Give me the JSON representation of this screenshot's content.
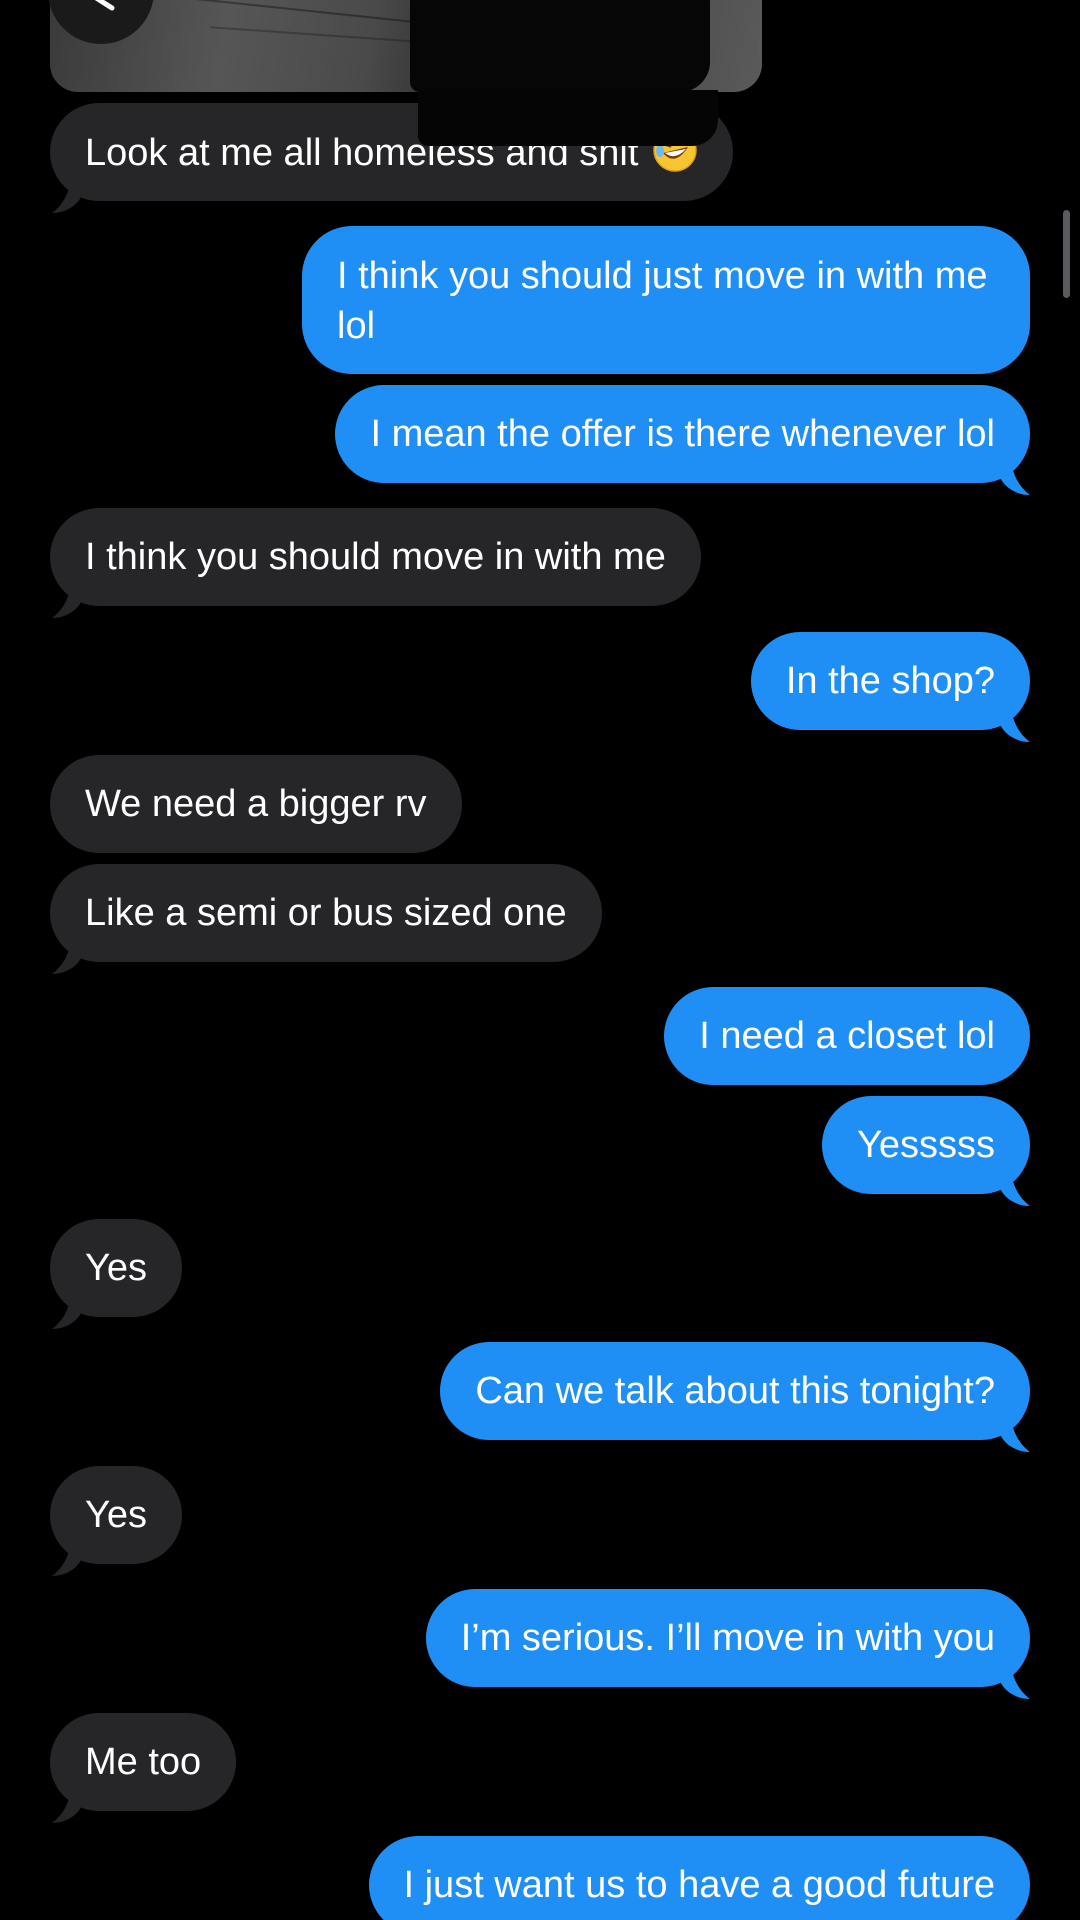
{
  "thread": {
    "messages": [
      {
        "id": 1,
        "direction": "incoming",
        "text": "Look at me all homeless and shit",
        "emoji": "rolling-on-floor-laughing",
        "tail": true
      },
      {
        "id": 2,
        "direction": "outgoing",
        "text": "I think you should just move in with me lol",
        "tail": false
      },
      {
        "id": 3,
        "direction": "outgoing",
        "text": "I mean the offer is there whenever lol",
        "tail": true
      },
      {
        "id": 4,
        "direction": "incoming",
        "text": "I think you should move in with me",
        "tail": true
      },
      {
        "id": 5,
        "direction": "outgoing",
        "text": "In the shop?",
        "tail": true
      },
      {
        "id": 6,
        "direction": "incoming",
        "text": "We need a bigger rv",
        "tail": false
      },
      {
        "id": 7,
        "direction": "incoming",
        "text": "Like a semi or bus sized one",
        "tail": true
      },
      {
        "id": 8,
        "direction": "outgoing",
        "text": "I need a closet lol",
        "tail": false
      },
      {
        "id": 9,
        "direction": "outgoing",
        "text": "Yesssss",
        "tail": true
      },
      {
        "id": 10,
        "direction": "incoming",
        "text": "Yes",
        "tail": true
      },
      {
        "id": 11,
        "direction": "outgoing",
        "text": "Can we talk about this tonight?",
        "tail": true
      },
      {
        "id": 12,
        "direction": "incoming",
        "text": "Yes",
        "tail": true
      },
      {
        "id": 13,
        "direction": "outgoing",
        "text": "I’m serious. I’ll move in with you",
        "tail": true
      },
      {
        "id": 14,
        "direction": "incoming",
        "text": "Me too",
        "tail": true
      },
      {
        "id": 15,
        "direction": "outgoing",
        "text": "I just want us to have a good future",
        "tail": false
      }
    ]
  },
  "colors": {
    "background": "#000000",
    "incoming_bubble": "#262628",
    "outgoing_bubble": "#1f8ff6",
    "text": "#ffffff"
  },
  "icons": {
    "back": "chevron-left-icon",
    "emoji": "rolling-on-floor-laughing-emoji"
  }
}
